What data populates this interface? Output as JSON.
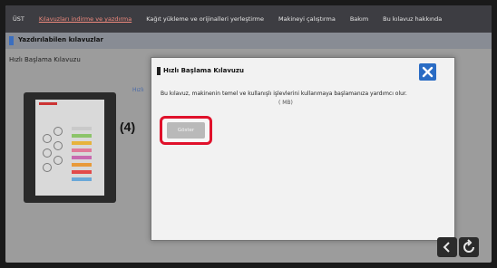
{
  "topbar": {
    "tabs": [
      {
        "label": "ÜST",
        "active": false
      },
      {
        "label": "Kılavuzları indirme ve yazdırma",
        "active": true
      },
      {
        "label": "Kağıt yükleme ve orijinalleri yerleştirme",
        "active": false
      },
      {
        "label": "Makineyi çalıştırma",
        "active": false
      },
      {
        "label": "Bakım",
        "active": false
      },
      {
        "label": "Bu kılavuz hakkında",
        "active": false
      }
    ]
  },
  "section": {
    "title": "Yazdırılabilen kılavuzlar",
    "item_label": "Hızlı Başlama Kılavuzu",
    "behind_link": "Hızlı"
  },
  "dialog": {
    "title": "Hızlı Başlama Kılavuzu",
    "message": "Bu kılavuz, makinenin temel ve kullanışlı işlevlerini kullanmaya başlamanıza yardımcı olur.",
    "size_hint": "(     MB)",
    "open_button": "Göster"
  },
  "callout": {
    "step_label": "(4)"
  },
  "colors": {
    "accent": "#2a6cc4",
    "highlight": "#e0112b",
    "active_tab": "#f08a7e"
  }
}
